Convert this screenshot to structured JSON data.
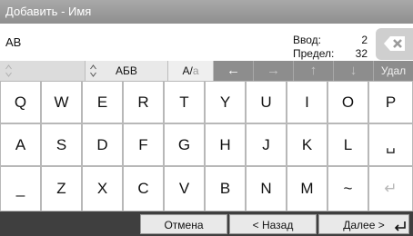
{
  "title": "Добавить - Имя",
  "input": {
    "value": "АВ"
  },
  "counter": {
    "input_label": "Ввод:",
    "input_value": "2",
    "limit_label": "Предел:",
    "limit_value": "32"
  },
  "toolbar": {
    "layout_label": "АБВ",
    "case_main": "A/",
    "case_dim": "a",
    "left_arrow": "←",
    "right_arrow": "→",
    "up_arrow": "↑",
    "down_arrow": "↓",
    "delete_label": "Удал"
  },
  "keys": {
    "row1": [
      "Q",
      "W",
      "E",
      "R",
      "T",
      "Y",
      "U",
      "I",
      "O",
      "P"
    ],
    "row2": [
      "A",
      "S",
      "D",
      "F",
      "G",
      "H",
      "J",
      "K",
      "L",
      "␣"
    ],
    "row3": [
      "_",
      "Z",
      "X",
      "C",
      "V",
      "B",
      "N",
      "M",
      "~",
      "↵"
    ]
  },
  "buttons": {
    "cancel": "Отмена",
    "back": "< Назад",
    "next": "Далее >"
  },
  "colors": {
    "titlebar": "#9e9e9e",
    "control_dark": "#8d8d8d",
    "bottom_bar": "#3f3f3f"
  }
}
